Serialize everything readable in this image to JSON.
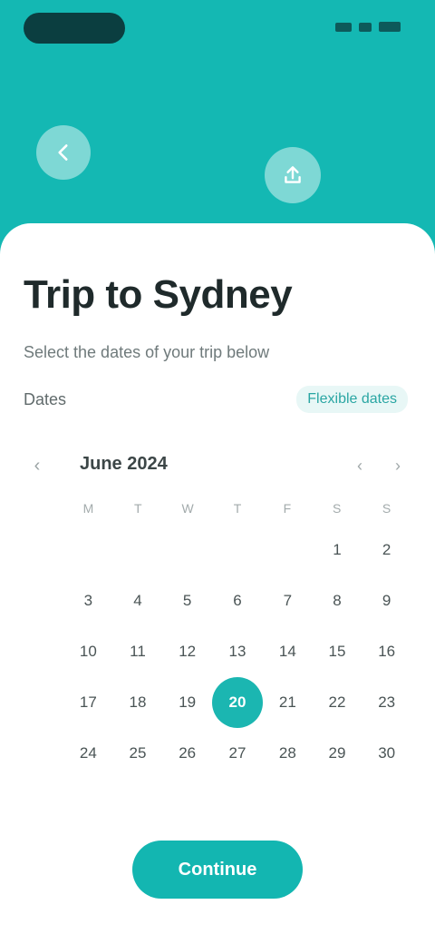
{
  "header": {
    "back_icon": "arrow-left-icon",
    "share_icon": "share-icon"
  },
  "trip": {
    "title": "Trip to Sydney",
    "subtitle": "Select the dates of your trip below"
  },
  "dates": {
    "label": "Dates",
    "link": "Flexible dates"
  },
  "calendar": {
    "month": "June 2024",
    "weekdays": [
      "M",
      "T",
      "W",
      "T",
      "F",
      "S",
      "S"
    ],
    "leading_blanks": 5,
    "days": [
      "1",
      "2",
      "3",
      "4",
      "5",
      "6",
      "7",
      "8",
      "9",
      "10",
      "11",
      "12",
      "13",
      "14",
      "15",
      "16",
      "17",
      "18",
      "19",
      "20",
      "21",
      "22",
      "23",
      "24",
      "25",
      "26",
      "27",
      "28",
      "29",
      "30"
    ],
    "selected": "20"
  },
  "cta": {
    "label": "Continue"
  },
  "colors": {
    "primary": "#14b8b3",
    "selected_day": "#1bb6b1",
    "title_text": "#1f2a2b"
  }
}
